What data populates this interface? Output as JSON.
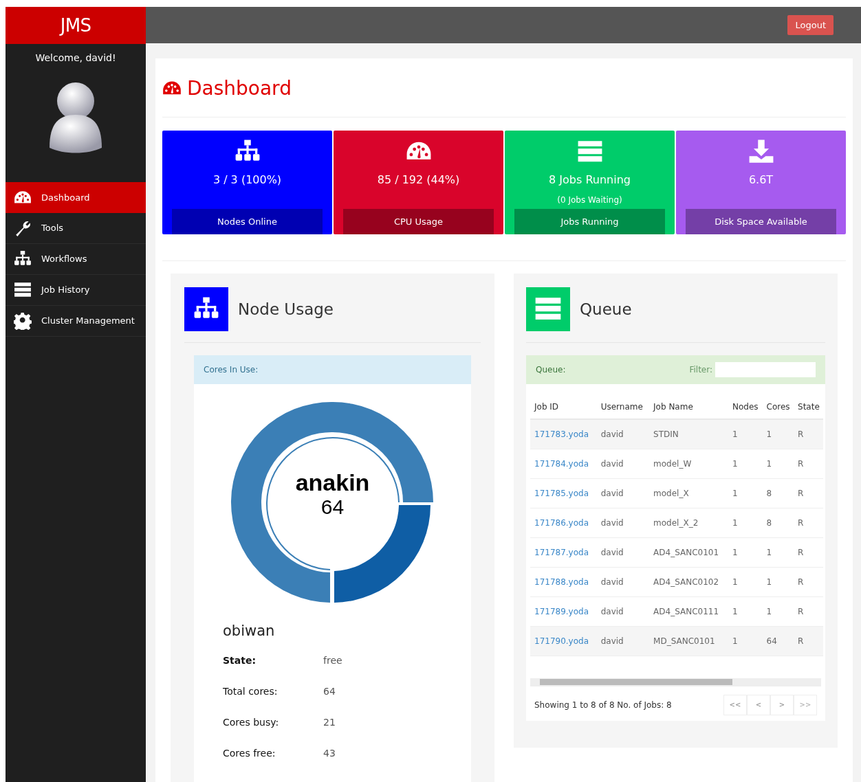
{
  "brand": "JMS",
  "logout": "Logout",
  "welcome": "Welcome, david!",
  "sidebar": {
    "items": [
      {
        "kind": "gauge",
        "label": "Dashboard",
        "selected": true
      },
      {
        "kind": "wrench",
        "label": "Tools",
        "selected": false
      },
      {
        "kind": "sitemap",
        "label": "Workflows",
        "selected": false
      },
      {
        "kind": "server",
        "label": "Job History",
        "selected": false
      },
      {
        "kind": "gear",
        "label": "Cluster Management",
        "selected": false
      }
    ]
  },
  "title": "Dashboard",
  "stats": [
    {
      "kind": "sitemap",
      "value": "3 / 3 (100%)",
      "label": "Nodes Online",
      "color": "#0000ff"
    },
    {
      "kind": "gauge",
      "value": "85 / 192 (44%)",
      "label": "CPU Usage",
      "color": "#d9042b"
    },
    {
      "kind": "server",
      "value": "8 Jobs Running",
      "sub": "(0 Jobs Waiting)",
      "label": "Jobs Running",
      "color": "#00cc6a"
    },
    {
      "kind": "download",
      "value": "6.6T",
      "label": "Disk Space Available",
      "color": "#a65bef"
    }
  ],
  "node_usage": {
    "title": "Node Usage",
    "card_title": "Cores In Use:",
    "donut_name": "anakin",
    "donut_value": "64",
    "node": "obiwan",
    "details": [
      {
        "label": "State:",
        "value": "free"
      },
      {
        "label": "Total cores:",
        "value": "64"
      },
      {
        "label": "Cores busy:",
        "value": "21"
      },
      {
        "label": "Cores free:",
        "value": "43"
      }
    ]
  },
  "queue": {
    "title": "Queue",
    "card_title": "Queue:",
    "filter_label": "Filter:",
    "columns": [
      "Job ID",
      "Username",
      "Job Name",
      "Nodes",
      "Cores",
      "State"
    ],
    "rows": [
      [
        "171783.yoda",
        "david",
        "STDIN",
        "1",
        "1",
        "R"
      ],
      [
        "171784.yoda",
        "david",
        "model_W",
        "1",
        "1",
        "R"
      ],
      [
        "171785.yoda",
        "david",
        "model_X",
        "1",
        "8",
        "R"
      ],
      [
        "171786.yoda",
        "david",
        "model_X_2",
        "1",
        "8",
        "R"
      ],
      [
        "171787.yoda",
        "david",
        "AD4_SANC0101",
        "1",
        "1",
        "R"
      ],
      [
        "171788.yoda",
        "david",
        "AD4_SANC0102",
        "1",
        "1",
        "R"
      ],
      [
        "171789.yoda",
        "david",
        "AD4_SANC0111",
        "1",
        "1",
        "R"
      ],
      [
        "171790.yoda",
        "david",
        "MD_SANC0101",
        "1",
        "64",
        "R"
      ]
    ],
    "summary": "Showing 1 to 8 of 8 No. of Jobs: 8",
    "pager": [
      "<<",
      "<",
      ">",
      ">>"
    ]
  }
}
